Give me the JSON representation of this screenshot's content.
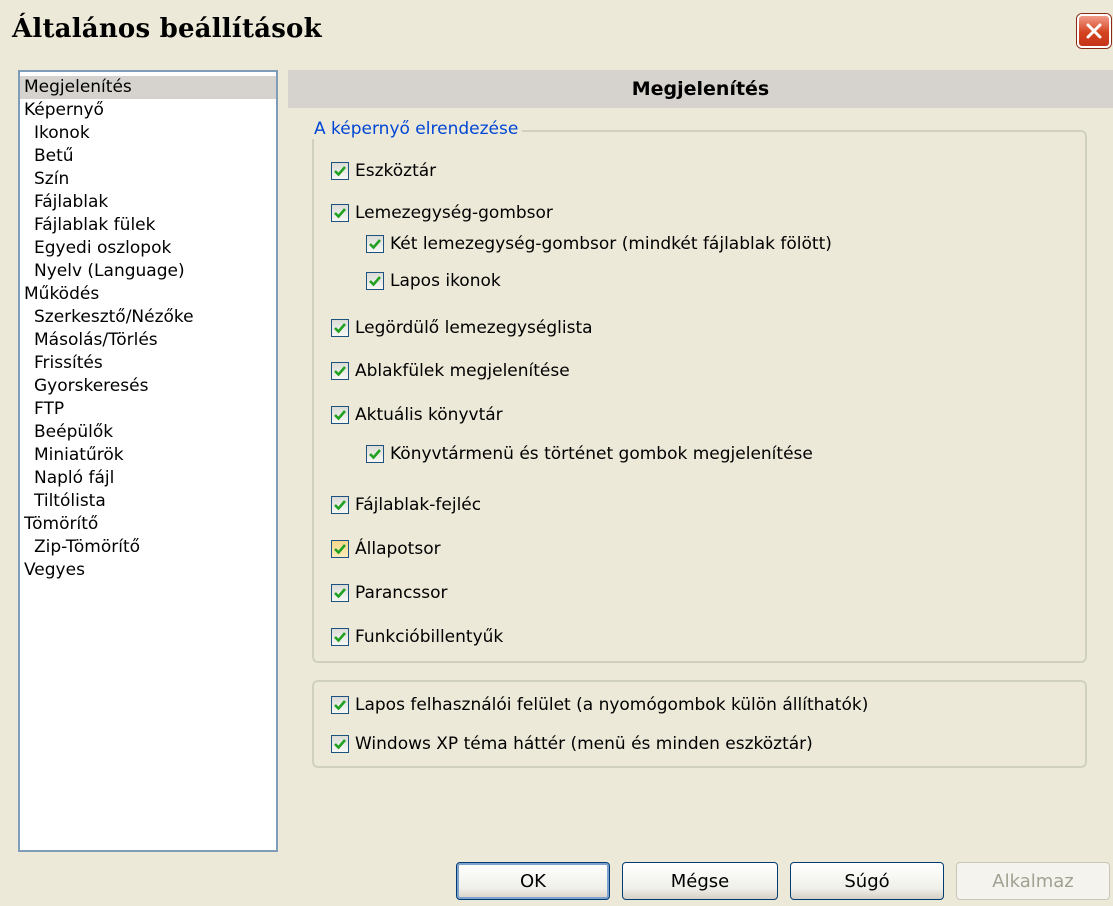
{
  "window": {
    "title": "Általános beállítások"
  },
  "tree": [
    {
      "label": "Megjelenítés",
      "level": 0,
      "selected": true
    },
    {
      "label": "Képernyő",
      "level": 0
    },
    {
      "label": "Ikonok",
      "level": 1
    },
    {
      "label": "Betű",
      "level": 1
    },
    {
      "label": "Szín",
      "level": 1
    },
    {
      "label": "Fájlablak",
      "level": 1
    },
    {
      "label": "Fájlablak fülek",
      "level": 1
    },
    {
      "label": "Egyedi oszlopok",
      "level": 1
    },
    {
      "label": "Nyelv (Language)",
      "level": 1
    },
    {
      "label": "Működés",
      "level": 0
    },
    {
      "label": "Szerkesztő/Nézőke",
      "level": 1
    },
    {
      "label": "Másolás/Törlés",
      "level": 1
    },
    {
      "label": "Frissítés",
      "level": 1
    },
    {
      "label": "Gyorskeresés",
      "level": 1
    },
    {
      "label": "FTP",
      "level": 1
    },
    {
      "label": "Beépülők",
      "level": 1
    },
    {
      "label": "Miniatűrök",
      "level": 1
    },
    {
      "label": "Napló fájl",
      "level": 1
    },
    {
      "label": "Tiltólista",
      "level": 1
    },
    {
      "label": "Tömörítő",
      "level": 0
    },
    {
      "label": "Zip-Tömörítő",
      "level": 1
    },
    {
      "label": "Vegyes",
      "level": 0
    }
  ],
  "panel": {
    "header": "Megjelenítés",
    "group1": {
      "legend": "A képernyő elrendezése",
      "checkboxes": [
        {
          "label": "Eszköztár",
          "checked": true
        },
        {
          "label": "Lemezegység-gombsor",
          "checked": true
        },
        {
          "label": "Két lemezegység-gombsor (mindkét fájlablak fölött)",
          "checked": true
        },
        {
          "label": "Lapos ikonok",
          "checked": true
        },
        {
          "label": "Legördülő lemezegységlista",
          "checked": true
        },
        {
          "label": "Ablakfülek megjelenítése",
          "checked": true
        },
        {
          "label": "Aktuális könyvtár",
          "checked": true
        },
        {
          "label": "Könyvtármenü és történet gombok megjelenítése",
          "checked": true
        },
        {
          "label": "Fájlablak-fejléc",
          "checked": true
        },
        {
          "label": "Állapotsor",
          "checked": true
        },
        {
          "label": "Parancssor",
          "checked": true
        },
        {
          "label": "Funkcióbillentyűk",
          "checked": true
        }
      ]
    },
    "group2": {
      "checkboxes": [
        {
          "label": "Lapos felhasználói felület (a nyomógombok külön állíthatók)",
          "checked": true
        },
        {
          "label": "Windows XP téma háttér (menü és minden eszköztár)",
          "checked": true
        }
      ]
    }
  },
  "buttons": {
    "ok": "OK",
    "cancel": "Mégse",
    "help": "Súgó",
    "apply": "Alkalmaz"
  },
  "colors": {
    "check": "#21a121",
    "legend": "#0046d5",
    "close": "#d4431f"
  }
}
